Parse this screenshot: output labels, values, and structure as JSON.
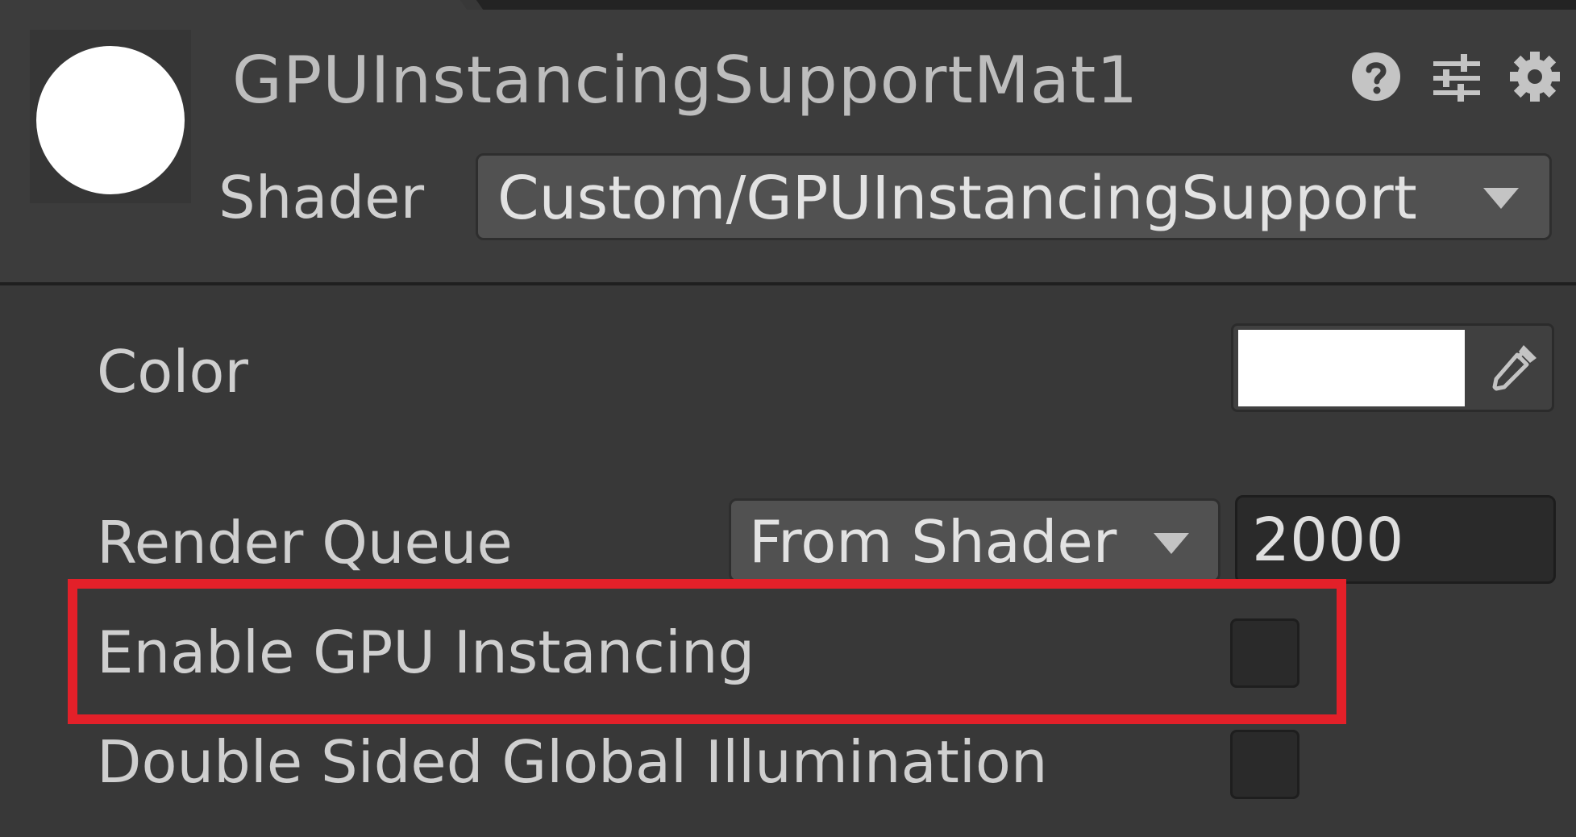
{
  "material": {
    "name": "GPUInstancingSupportMat1",
    "preview_color": "#ffffff"
  },
  "header_icons": {
    "help": "help-icon",
    "presets": "presets-icon",
    "settings": "gear-icon"
  },
  "shader": {
    "label": "Shader",
    "value": "Custom/GPUInstancingSupport"
  },
  "properties": {
    "color": {
      "label": "Color",
      "value": "#ffffff",
      "picker_icon": "eyedropper-icon"
    },
    "render_queue": {
      "label": "Render Queue",
      "mode": "From Shader",
      "value": "2000"
    },
    "gpu_instancing": {
      "label": "Enable GPU Instancing",
      "checked": false
    },
    "double_sided_gi": {
      "label": "Double Sided Global Illumination",
      "checked": false
    }
  },
  "annotation": {
    "highlight_color": "#e32029"
  }
}
